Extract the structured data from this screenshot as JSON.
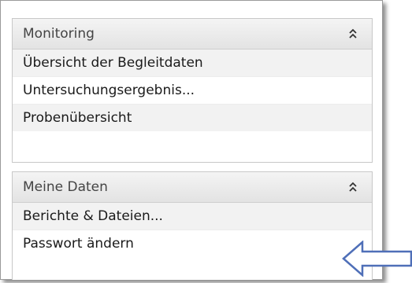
{
  "monitoring": {
    "title": "Monitoring",
    "collapse_icon": "double-chevron-up-icon",
    "items": [
      {
        "label": "Übersicht der Begleitdaten"
      },
      {
        "label": "Untersuchungsergebnis..."
      },
      {
        "label": "Probenübersicht"
      }
    ]
  },
  "meine_daten": {
    "title": "Meine Daten",
    "collapse_icon": "double-chevron-up-icon",
    "items": [
      {
        "label": "Berichte & Dateien..."
      },
      {
        "label": "Passwort ändern"
      }
    ]
  },
  "annotation": {
    "icon": "left-arrow-icon",
    "color": "#4f6fb8"
  }
}
